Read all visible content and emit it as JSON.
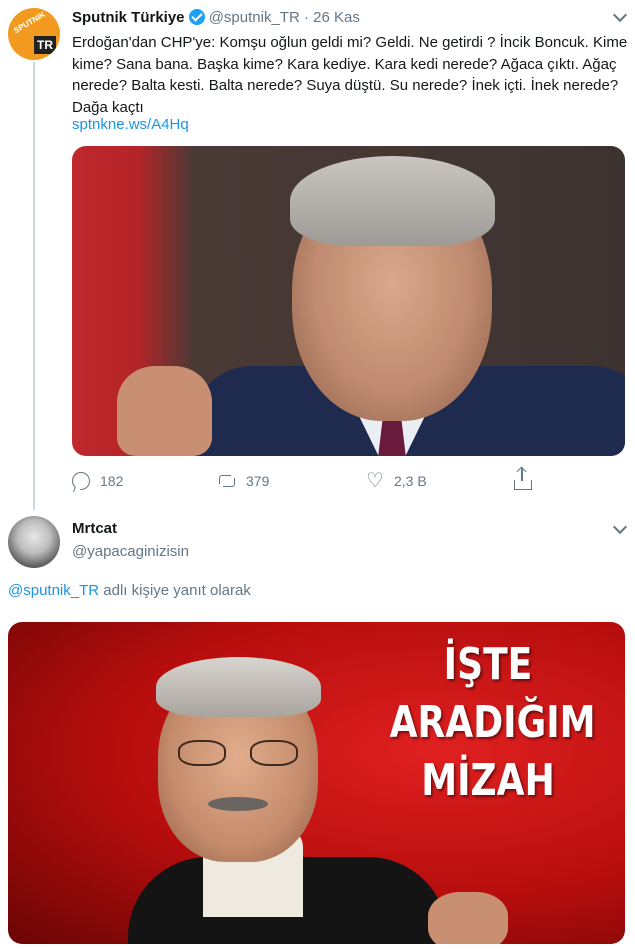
{
  "tweet1": {
    "avatar_text_top": "SPUTNIK",
    "avatar_text_badge": "TR",
    "name": "Sputnik Türkiye",
    "handle": "@sputnik_TR",
    "separator": "·",
    "date": "26 Kas",
    "text": "Erdoğan'dan CHP'ye: Komşu oğlun geldi mi? Geldi. Ne getirdi ? İncik Boncuk. Kime kime? Sana bana. Başka kime? Kara kediye. Kara kedi nerede? Ağaca çıktı. Ağaç nerede? Balta kesti. Balta nerede? Suya düştü. Su nerede? İnek içti. İnek nerede? Dağa kaçtı",
    "link": "sptnkne.ws/A4Hq",
    "stats": {
      "replies": "182",
      "retweets": "379",
      "likes": "2,3 B"
    }
  },
  "tweet2": {
    "name": "Mrtcat",
    "handle": "@yapacaginizisin",
    "reply_mention": "@sputnik_TR",
    "reply_suffix": " adlı kişiye yanıt olarak",
    "meme_lines": [
      "İŞTE",
      "ARADIĞIM",
      "MİZAH"
    ]
  },
  "colors": {
    "link": "#1b95e0",
    "secondary_text": "#657786",
    "verified": "#1da1f2",
    "thread_line": "#ccd6dd"
  },
  "icons": [
    "verified-icon",
    "chevron-down-icon",
    "reply-icon",
    "retweet-icon",
    "like-icon",
    "share-icon"
  ]
}
